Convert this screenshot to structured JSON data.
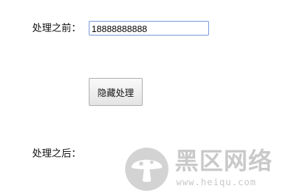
{
  "form": {
    "before_label": "处理之前：",
    "phone_input_value": "18888888888",
    "hide_button_label": "隐藏处理",
    "after_label": "处理之后："
  },
  "watermark": {
    "site_name": "黑区网络",
    "site_url": "www.heiqu.com",
    "accent_color": "#c9c9c9",
    "icon": "mushroom-logo-icon"
  }
}
